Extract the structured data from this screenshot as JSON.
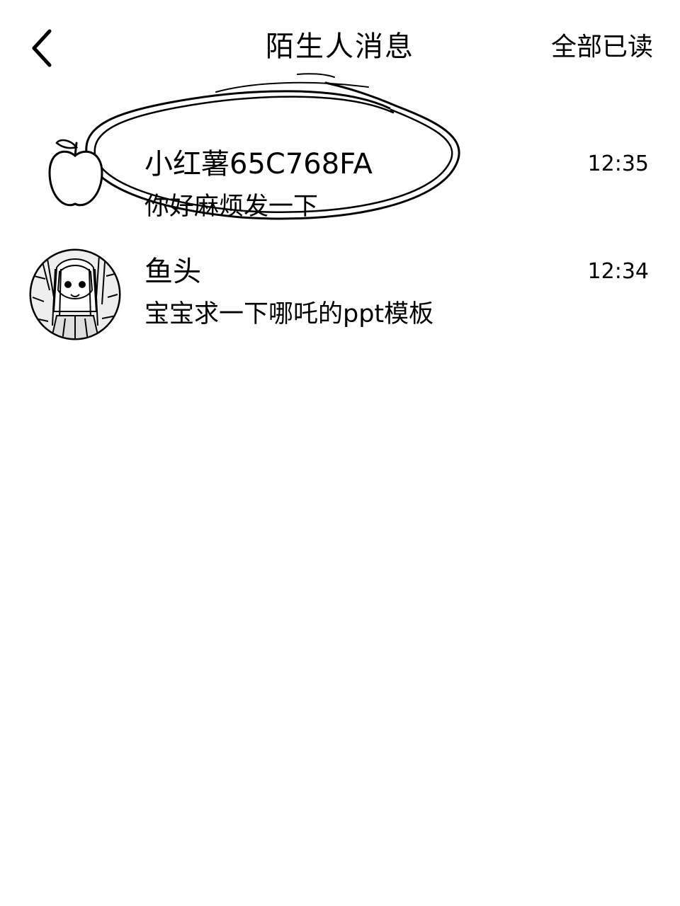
{
  "header": {
    "back_icon": "chevron-left-icon",
    "title": "陌生人消息",
    "read_all_label": "全部已读"
  },
  "messages": [
    {
      "avatar": "apple-outline-icon",
      "name": "小红薯65C768FA",
      "preview": "你好麻烦发一下",
      "time": "12:35"
    },
    {
      "avatar": "anime-girl-avatar",
      "name": "鱼头",
      "preview": "宝宝求一下哪吒的ppt模板",
      "time": "12:34"
    }
  ],
  "colors": {
    "background": "#ffffff",
    "text": "#000000"
  }
}
